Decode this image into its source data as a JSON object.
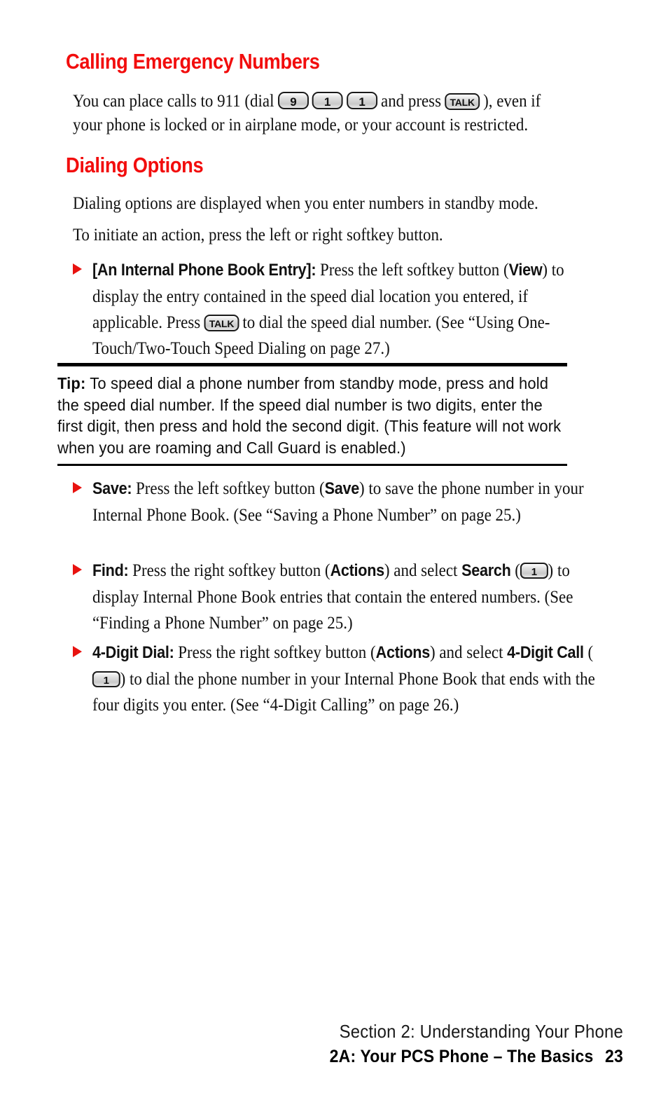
{
  "page": {
    "number": "23",
    "background": "#ffffff",
    "accent_red": "#f20d0d"
  },
  "sections": [
    {
      "heading": "Calling Emergency Numbers",
      "intro_parts": {
        "a": "You can place calls to 911 (dial",
        "key1": "9",
        "key2": "1",
        "key3": "1",
        "b": "and press",
        "key_talk": "TALK",
        "c": "), even if your phone is locked or in airplane mode, or your account is restricted."
      }
    },
    {
      "heading": "Dialing Options",
      "para1": "Dialing options are displayed when you enter numbers in standby mode.",
      "para2": "To initiate an action, press the left or right softkey button."
    }
  ],
  "bullets": [
    {
      "id": "internal-phone-book-entry",
      "label": "[An Internal Phone Book Entry]:",
      "t1": " Press the left softkey button (",
      "b1": "View",
      "t2": ") to display the entry contained in the speed dial location you entered, if applicable. Press",
      "key": "TALK",
      "t3": "to dial the speed dial number. (See “Using One-Touch/Two-Touch Speed Dialing on page 27.)"
    },
    {
      "id": "save",
      "label": "Save:",
      "t1": " Press the left softkey button (",
      "b1": "Save",
      "t2": ") to save the phone number in your Internal Phone Book. (See “Saving a Phone Number” on page 25.)"
    },
    {
      "id": "find",
      "label": "Find:",
      "t1": " Press the right softkey button (",
      "b1": "Actions",
      "t2": ") and select ",
      "b2": "Search",
      "t3": " (",
      "key": "1",
      "t4": ") to display Internal Phone Book entries that contain the entered numbers. (See “Finding a Phone Number” on page 25.)"
    },
    {
      "id": "four-digit-dial",
      "label": "4-Digit Dial:",
      "t1": " Press the right softkey button (",
      "b1": "Actions",
      "t2": ") and select ",
      "b2": "4-Digit Call",
      "t3": " (",
      "key": "1",
      "t4": ") to dial the phone number in your Internal Phone Book that ends with the four digits you enter. (See “4-Digit Calling” on page 26.)"
    }
  ],
  "tip": {
    "label": "Tip:",
    "text": " To speed dial a phone number from standby mode, press and hold the speed dial number. If the speed dial number is two digits, enter the first digit, then press and hold the second digit. (This feature will not work when you are roaming and Call Guard is enabled.)"
  },
  "footer": {
    "line1": "Section 2: Understanding Your Phone",
    "line2": "2A: Your PCS Phone – The Basics",
    "page_number": "23"
  }
}
